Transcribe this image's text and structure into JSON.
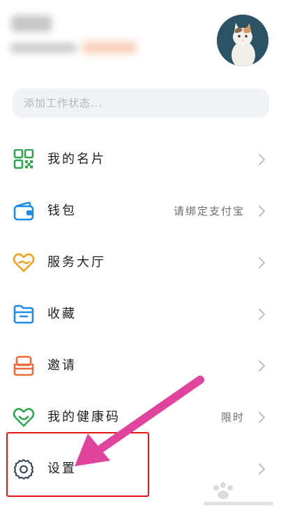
{
  "status": {
    "placeholder": "添加工作状态..."
  },
  "menu": [
    {
      "label": "我的名片",
      "icon": "qr-code-icon",
      "extra": ""
    },
    {
      "label": "钱包",
      "icon": "wallet-icon",
      "extra": "请绑定支付宝"
    },
    {
      "label": "服务大厅",
      "icon": "heart-hands-icon",
      "extra": ""
    },
    {
      "label": "收藏",
      "icon": "folder-icon",
      "extra": ""
    },
    {
      "label": "邀请",
      "icon": "invite-box-icon",
      "extra": ""
    },
    {
      "label": "我的健康码",
      "icon": "health-heart-icon",
      "extra": "限时"
    },
    {
      "label": "设置",
      "icon": "gear-icon",
      "extra": ""
    }
  ],
  "colors": {
    "highlight_box": "#e21818",
    "arrow": "#e0449c",
    "green": "#2ea74f",
    "blue": "#1e8be6",
    "orange": "#f2a21e",
    "red_orange": "#ef6a3a"
  }
}
